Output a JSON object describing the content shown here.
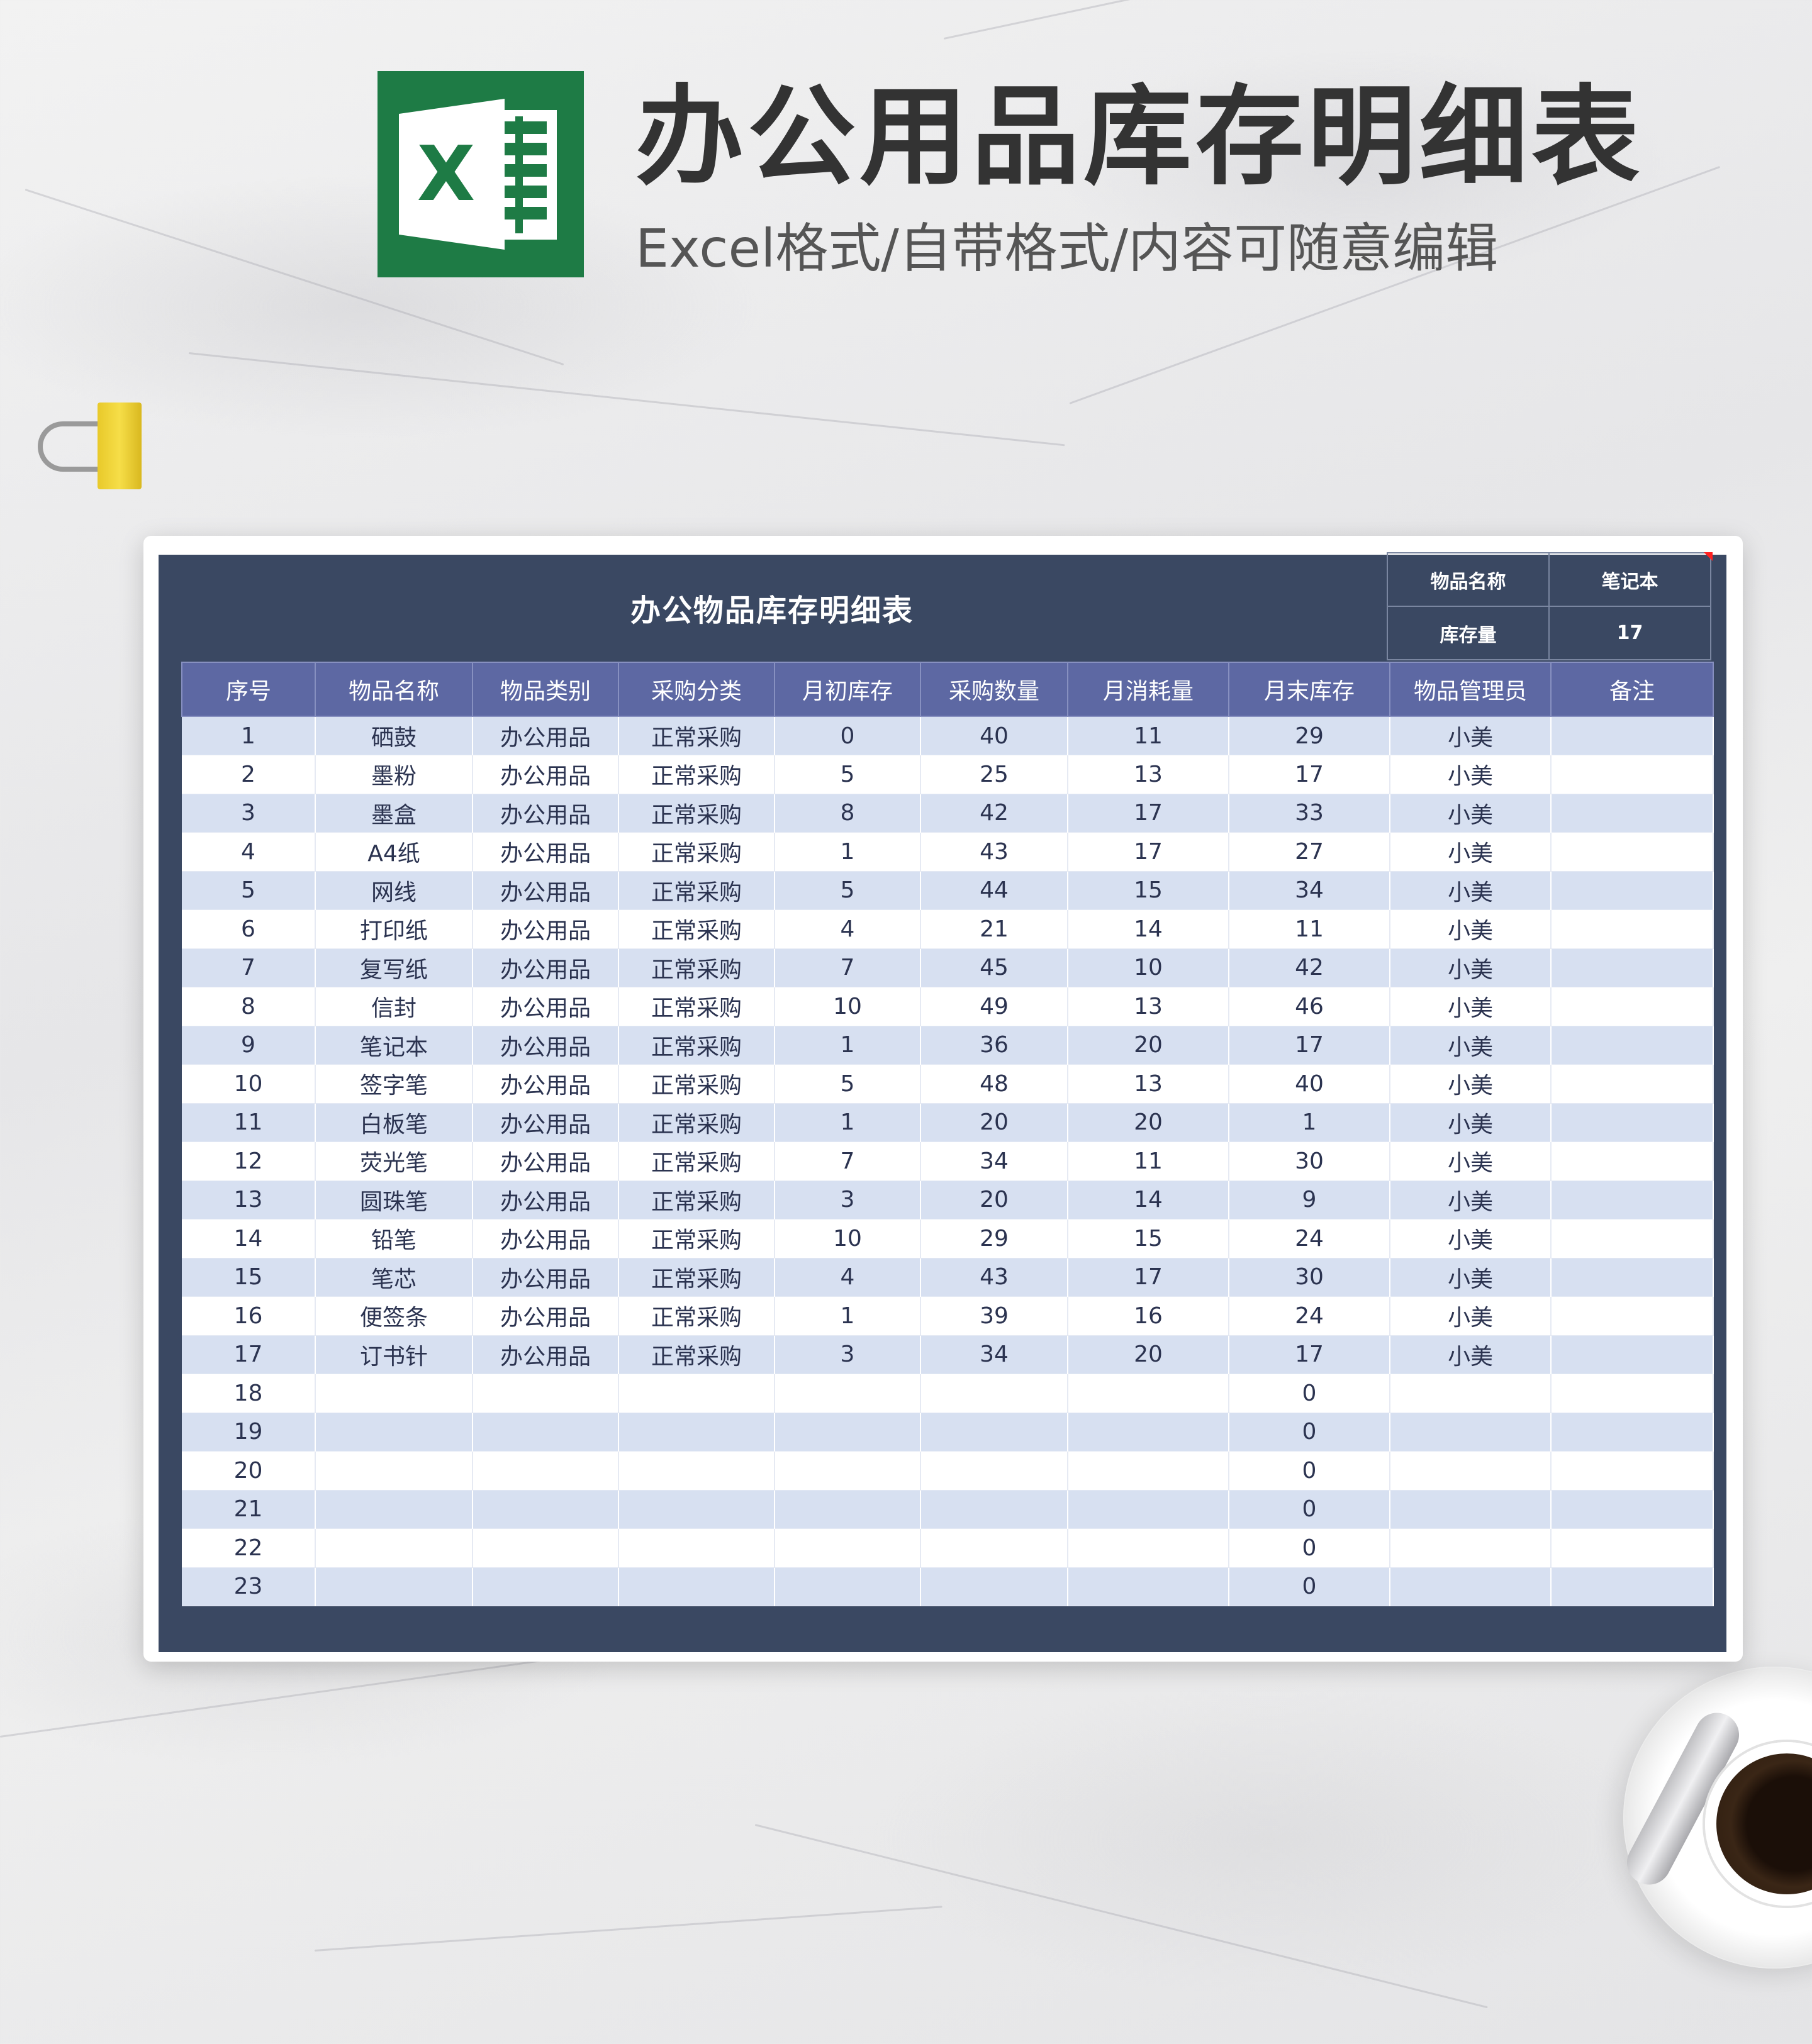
{
  "header": {
    "title": "办公用品库存明细表",
    "subtitle": "Excel格式/自带格式/内容可随意编辑",
    "logo_letter": "X"
  },
  "sheet": {
    "title": "办公物品库存明细表",
    "info": {
      "item_label": "物品名称",
      "item_value": "笔记本",
      "stock_label": "库存量",
      "stock_value": "17"
    },
    "columns": [
      "序号",
      "物品名称",
      "物品类别",
      "采购分类",
      "月初库存",
      "采购数量",
      "月消耗量",
      "月末库存",
      "物品管理员",
      "备注"
    ],
    "rows": [
      [
        "1",
        "硒鼓",
        "办公用品",
        "正常采购",
        "0",
        "40",
        "11",
        "29",
        "小美",
        ""
      ],
      [
        "2",
        "墨粉",
        "办公用品",
        "正常采购",
        "5",
        "25",
        "13",
        "17",
        "小美",
        ""
      ],
      [
        "3",
        "墨盒",
        "办公用品",
        "正常采购",
        "8",
        "42",
        "17",
        "33",
        "小美",
        ""
      ],
      [
        "4",
        "A4纸",
        "办公用品",
        "正常采购",
        "1",
        "43",
        "17",
        "27",
        "小美",
        ""
      ],
      [
        "5",
        "网线",
        "办公用品",
        "正常采购",
        "5",
        "44",
        "15",
        "34",
        "小美",
        ""
      ],
      [
        "6",
        "打印纸",
        "办公用品",
        "正常采购",
        "4",
        "21",
        "14",
        "11",
        "小美",
        ""
      ],
      [
        "7",
        "复写纸",
        "办公用品",
        "正常采购",
        "7",
        "45",
        "10",
        "42",
        "小美",
        ""
      ],
      [
        "8",
        "信封",
        "办公用品",
        "正常采购",
        "10",
        "49",
        "13",
        "46",
        "小美",
        ""
      ],
      [
        "9",
        "笔记本",
        "办公用品",
        "正常采购",
        "1",
        "36",
        "20",
        "17",
        "小美",
        ""
      ],
      [
        "10",
        "签字笔",
        "办公用品",
        "正常采购",
        "5",
        "48",
        "13",
        "40",
        "小美",
        ""
      ],
      [
        "11",
        "白板笔",
        "办公用品",
        "正常采购",
        "1",
        "20",
        "20",
        "1",
        "小美",
        ""
      ],
      [
        "12",
        "荧光笔",
        "办公用品",
        "正常采购",
        "7",
        "34",
        "11",
        "30",
        "小美",
        ""
      ],
      [
        "13",
        "圆珠笔",
        "办公用品",
        "正常采购",
        "3",
        "20",
        "14",
        "9",
        "小美",
        ""
      ],
      [
        "14",
        "铅笔",
        "办公用品",
        "正常采购",
        "10",
        "29",
        "15",
        "24",
        "小美",
        ""
      ],
      [
        "15",
        "笔芯",
        "办公用品",
        "正常采购",
        "4",
        "43",
        "17",
        "30",
        "小美",
        ""
      ],
      [
        "16",
        "便签条",
        "办公用品",
        "正常采购",
        "1",
        "39",
        "16",
        "24",
        "小美",
        ""
      ],
      [
        "17",
        "订书针",
        "办公用品",
        "正常采购",
        "3",
        "34",
        "20",
        "17",
        "小美",
        ""
      ],
      [
        "18",
        "",
        "",
        "",
        "",
        "",
        "",
        "0",
        "",
        ""
      ],
      [
        "19",
        "",
        "",
        "",
        "",
        "",
        "",
        "0",
        "",
        ""
      ],
      [
        "20",
        "",
        "",
        "",
        "",
        "",
        "",
        "0",
        "",
        ""
      ],
      [
        "21",
        "",
        "",
        "",
        "",
        "",
        "",
        "0",
        "",
        ""
      ],
      [
        "22",
        "",
        "",
        "",
        "",
        "",
        "",
        "0",
        "",
        ""
      ],
      [
        "23",
        "",
        "",
        "",
        "",
        "",
        "",
        "0",
        "",
        ""
      ]
    ]
  },
  "colors": {
    "frame": "#3a4862",
    "header_row": "#5d68a3",
    "stripe": "#d7e0f1",
    "excel_green": "#1e7b45"
  }
}
